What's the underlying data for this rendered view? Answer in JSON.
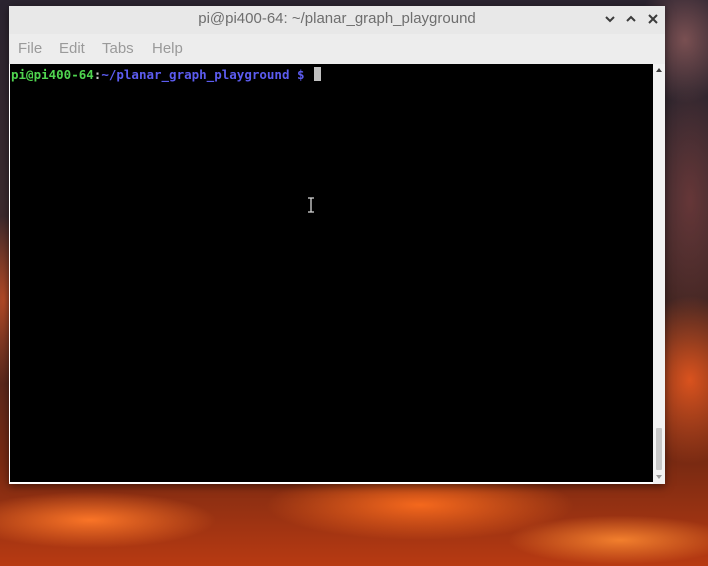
{
  "window": {
    "title": "pi@pi400-64: ~/planar_graph_playground",
    "controls": {
      "minimize_icon": "✕",
      "minimize": "⌄",
      "maximize": "⌃",
      "close": "✕"
    }
  },
  "menu": {
    "file": "File",
    "edit": "Edit",
    "tabs": "Tabs",
    "help": "Help"
  },
  "terminal": {
    "user_host": "pi@pi400-64",
    "colon": ":",
    "path": "~/planar_graph_playground",
    "dollar": " $ ",
    "colors": {
      "user_host": "#4fd44f",
      "path": "#5c5cf0",
      "background": "#000000"
    }
  },
  "icons": {
    "ibeam": "text-cursor-icon",
    "scroll_up": "scroll-up-arrow-icon",
    "scroll_down": "scroll-down-arrow-icon"
  }
}
